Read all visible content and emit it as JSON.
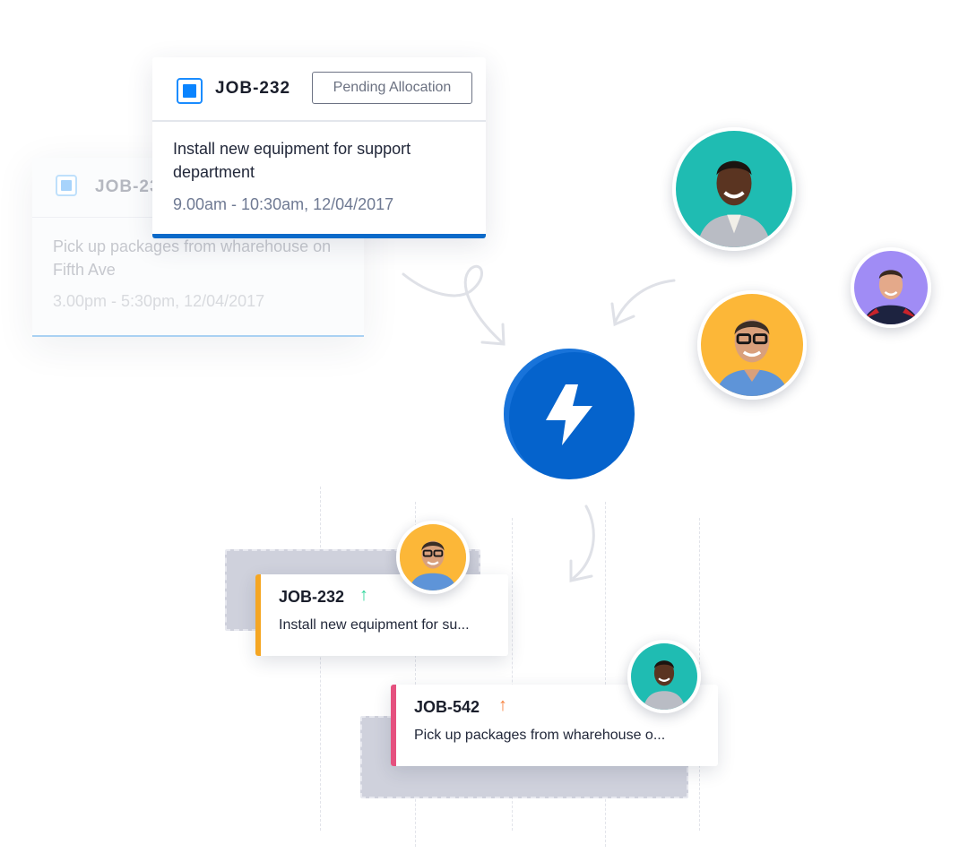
{
  "background_card": {
    "job_id": "JOB-232",
    "description": "Pick up packages from wharehouse on Fifth Ave",
    "time": "3.00pm - 5:30pm, 12/04/2017"
  },
  "main_card": {
    "job_id": "JOB-232",
    "status": "Pending Allocation",
    "description": "Install new equipment for support department",
    "time": "9.00am - 10:30am, 12/04/2017",
    "accent_color": "#0b6ac9"
  },
  "dispatch": {
    "icon": "lightning-icon",
    "color": "#0563cc"
  },
  "technicians": [
    {
      "name": "technician-woman",
      "bg_color": "#1fbcb2"
    },
    {
      "name": "technician-man-red-shirt",
      "bg_color": "#a08cf5"
    },
    {
      "name": "technician-man-glasses",
      "bg_color": "#fcb738"
    }
  ],
  "scheduled_jobs": [
    {
      "job_id": "JOB-232",
      "priority_icon": "arrow-up-icon",
      "priority_symbol": "↑",
      "priority_color": "#2ed69a",
      "description": "Install new equipment for su...",
      "stripe_color": "#f5a623",
      "assignee": "technician-man-glasses"
    },
    {
      "job_id": "JOB-542",
      "priority_icon": "arrow-up-icon",
      "priority_symbol": "↑",
      "priority_color": "#f77f3a",
      "description": "Pick up packages from wharehouse o...",
      "stripe_color": "#e5517f",
      "assignee": "technician-woman"
    }
  ]
}
